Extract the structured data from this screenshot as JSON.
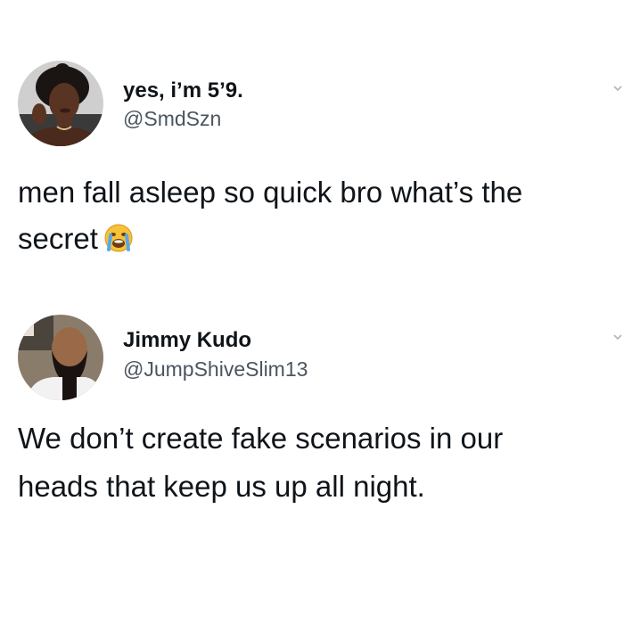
{
  "tweets": [
    {
      "display_name": "yes, i’m 5’9.",
      "handle": "@SmdSzn",
      "text_lines": [
        "men fall asleep so quick bro what’s the",
        "secret"
      ],
      "emoji": "loudly-crying-face-icon",
      "avatar": "profile-photo-woman"
    },
    {
      "display_name": "Jimmy Kudo",
      "handle": "@JumpShiveSlim13",
      "text_lines": [
        "We don’t create fake scenarios in our",
        "heads that keep us up all night."
      ],
      "avatar": "profile-photo-man"
    }
  ],
  "colors": {
    "background": "#ffffff",
    "text": "#0f1419",
    "handle": "#4a5560"
  }
}
